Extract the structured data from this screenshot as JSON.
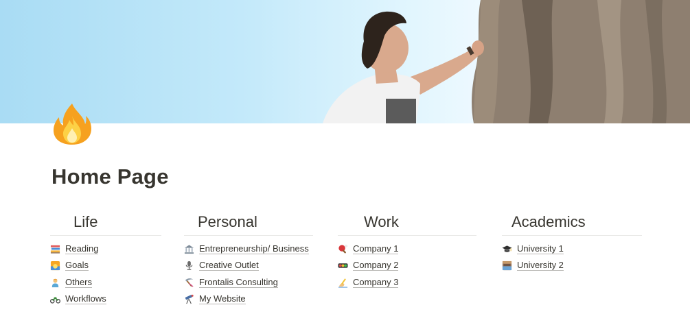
{
  "cover": {
    "description_colors": {
      "sky": "#c3e9fa",
      "rock": "#8e7f70"
    }
  },
  "page": {
    "icon": "fire-icon",
    "title": "Home Page"
  },
  "columns": [
    {
      "heading": "Life",
      "items": [
        {
          "label": "Reading",
          "icon": "books-icon"
        },
        {
          "label": "Goals",
          "icon": "sunrise-icon"
        },
        {
          "label": "Others",
          "icon": "person-icon"
        },
        {
          "label": "Workflows",
          "icon": "motorcycle-icon"
        }
      ]
    },
    {
      "heading": "Personal",
      "items": [
        {
          "label": "Entrepreneurship/ Business",
          "icon": "bank-icon"
        },
        {
          "label": "Creative Outlet",
          "icon": "microphone-icon"
        },
        {
          "label": "Frontalis Consulting",
          "icon": "pickaxe-icon"
        },
        {
          "label": "My Website",
          "icon": "telescope-icon"
        }
      ]
    },
    {
      "heading": "Work",
      "items": [
        {
          "label": "Company 1",
          "icon": "ping-pong-icon"
        },
        {
          "label": "Company 2",
          "icon": "traffic-light-icon"
        },
        {
          "label": "Company 3",
          "icon": "writing-hand-icon"
        }
      ]
    },
    {
      "heading": "Academics",
      "items": [
        {
          "label": "University 1",
          "icon": "graduation-cap-icon"
        },
        {
          "label": "University 2",
          "icon": "school-building-icon"
        }
      ]
    }
  ]
}
